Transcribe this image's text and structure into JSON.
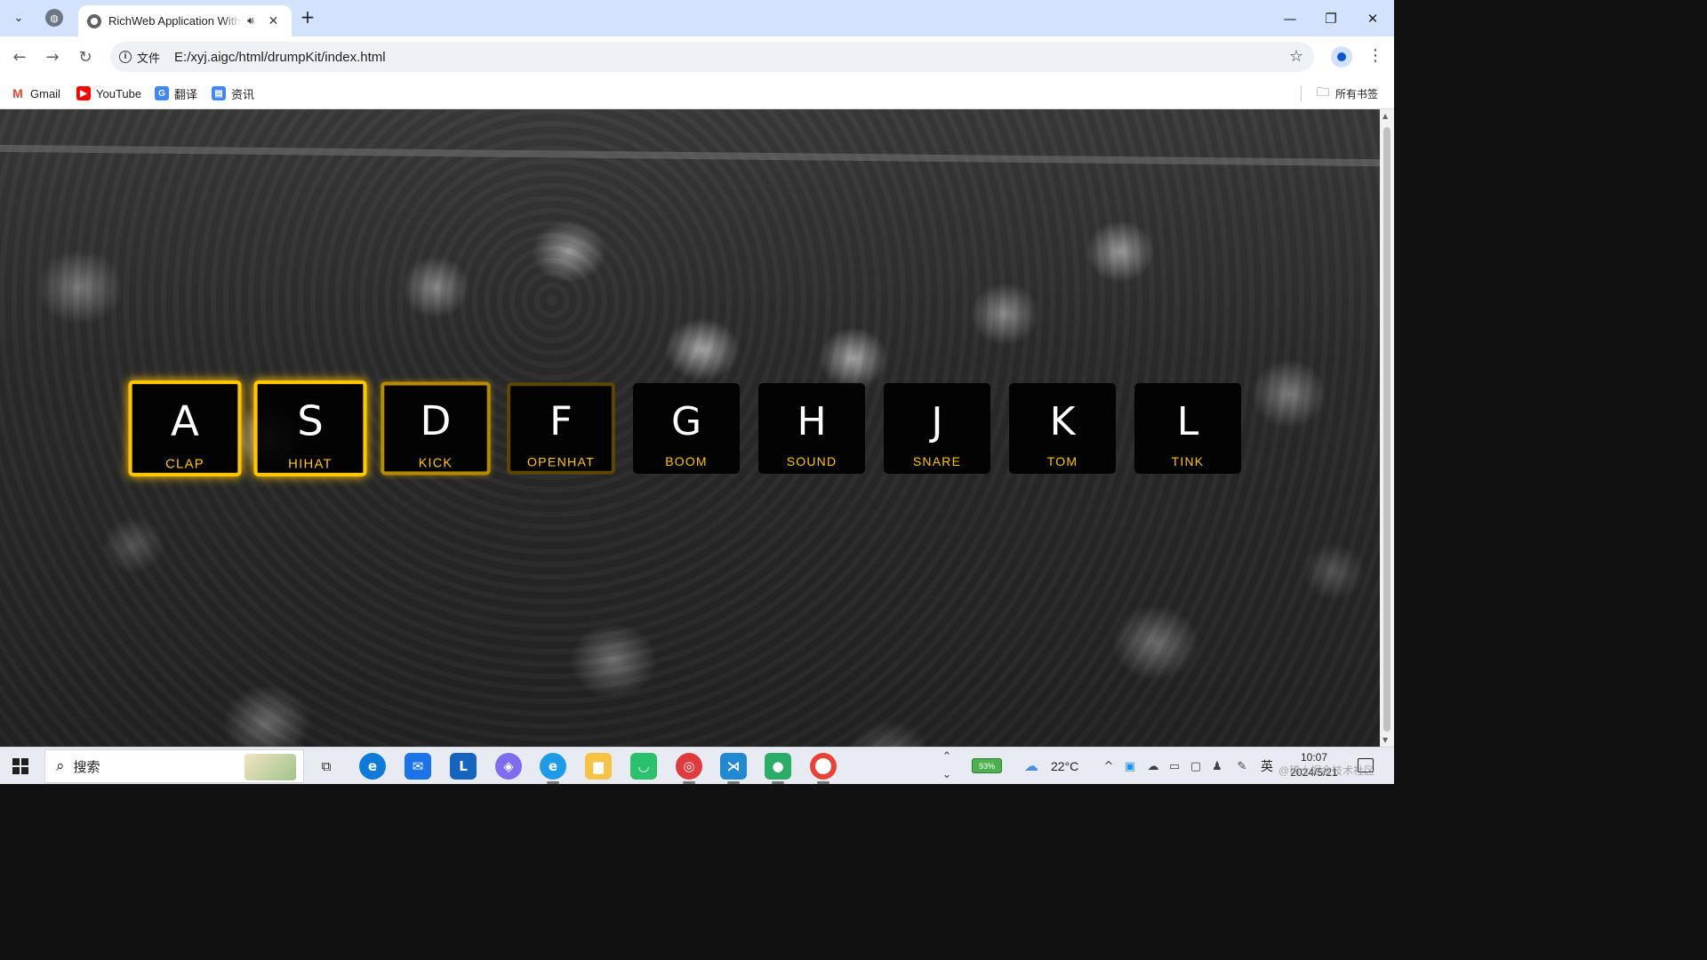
{
  "browser": {
    "tab": {
      "title": "RichWeb Application With Sound",
      "audio_icon": "speaker-icon",
      "close": "✕"
    },
    "new_tab": "+",
    "address": {
      "scheme_label": "文件",
      "url": "E:/xyj.aigc/html/drumpKit/index.html"
    },
    "bookmarks": [
      {
        "label": "Gmail",
        "icon": "gmail-icon",
        "color": "#ea4335"
      },
      {
        "label": "YouTube",
        "icon": "youtube-icon",
        "color": "#ff0000"
      },
      {
        "label": "翻译",
        "icon": "translate-icon",
        "color": "#4285f4"
      },
      {
        "label": "资讯",
        "icon": "news-icon",
        "color": "#4285f4"
      }
    ],
    "all_bookmarks": "所有书签"
  },
  "drumkit": {
    "accent_color": "#ffc600",
    "keys": [
      {
        "letter": "A",
        "sound": "CLAP",
        "state": "playing"
      },
      {
        "letter": "S",
        "sound": "HIHAT",
        "state": "playing"
      },
      {
        "letter": "D",
        "sound": "KICK",
        "state": "fading"
      },
      {
        "letter": "F",
        "sound": "OPENHAT",
        "state": "dim"
      },
      {
        "letter": "G",
        "sound": "BOOM",
        "state": "idle"
      },
      {
        "letter": "H",
        "sound": "SOUND",
        "state": "idle"
      },
      {
        "letter": "J",
        "sound": "SNARE",
        "state": "idle"
      },
      {
        "letter": "K",
        "sound": "TOM",
        "state": "idle"
      },
      {
        "letter": "L",
        "sound": "TINK",
        "state": "idle"
      }
    ]
  },
  "taskbar": {
    "search_placeholder": "搜索",
    "battery": "93%",
    "weather": "22°C",
    "ime": "英",
    "time": "10:07",
    "date": "2024/5/21",
    "watermark": "@稀土掘金技术社区"
  }
}
